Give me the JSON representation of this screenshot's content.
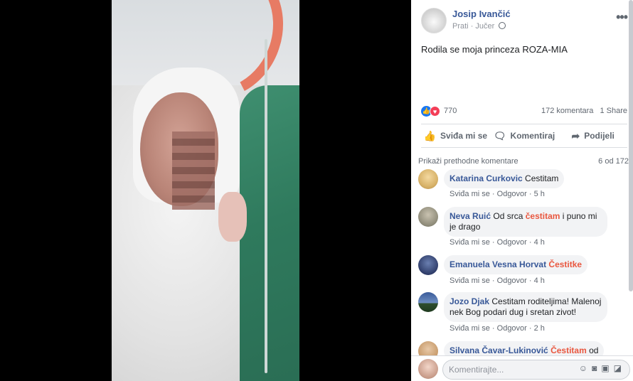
{
  "post": {
    "author": "Josip Ivančić",
    "follow": "Prati",
    "time": "Jučer",
    "text": "Rodila se moja princeza ROZA-MIA",
    "reaction_count": "770",
    "comment_count": "172 komentara",
    "share_count": "1 Share"
  },
  "actions": {
    "like": "Sviđa mi se",
    "comment": "Komentiraj",
    "share": "Podijeli"
  },
  "comments_header": {
    "previous": "Prikaži prethodne komentare",
    "pager": "6 od 172"
  },
  "comments": [
    {
      "name": "Katarina Curkovic",
      "text_before": "Cestitam",
      "highlight": "",
      "text_after": "",
      "like": "Sviđa mi se",
      "reply": "Odgovor",
      "time": "5 h"
    },
    {
      "name": "Neva Ruić",
      "text_before": "Od srca ",
      "highlight": "čestitam",
      "text_after": " i puno mi je drago",
      "like": "Sviđa mi se",
      "reply": "Odgovor",
      "time": "4 h"
    },
    {
      "name": "Emanuela Vesna Horvat",
      "text_before": "",
      "highlight": "Čestitke",
      "text_after": "",
      "like": "Sviđa mi se",
      "reply": "Odgovor",
      "time": "4 h"
    },
    {
      "name": "Jozo Djak",
      "text_before": "Cestitam roditeljima! Malenoj nek Bog podari dug i sretan zivot!",
      "highlight": "",
      "text_after": "",
      "like": "Sviđa mi se",
      "reply": "Odgovor",
      "time": "2 h"
    },
    {
      "name": "Silvana Čavar-Lukinović",
      "text_before": "",
      "highlight": "Čestitam",
      "text_after": " od",
      "like": "",
      "reply": "",
      "time": ""
    }
  ],
  "composer": {
    "placeholder": "Komentirajte..."
  },
  "colors": {
    "link_blue": "#385898",
    "highlight_red": "#e9573f",
    "like_blue": "#1877f2",
    "love_red": "#f33e58"
  },
  "icons": [
    "more-icon",
    "globe-icon",
    "like-icon",
    "love-icon",
    "thumb-icon",
    "comment-icon",
    "share-icon",
    "emoji-icon",
    "camera-icon",
    "gif-icon",
    "sticker-icon"
  ]
}
